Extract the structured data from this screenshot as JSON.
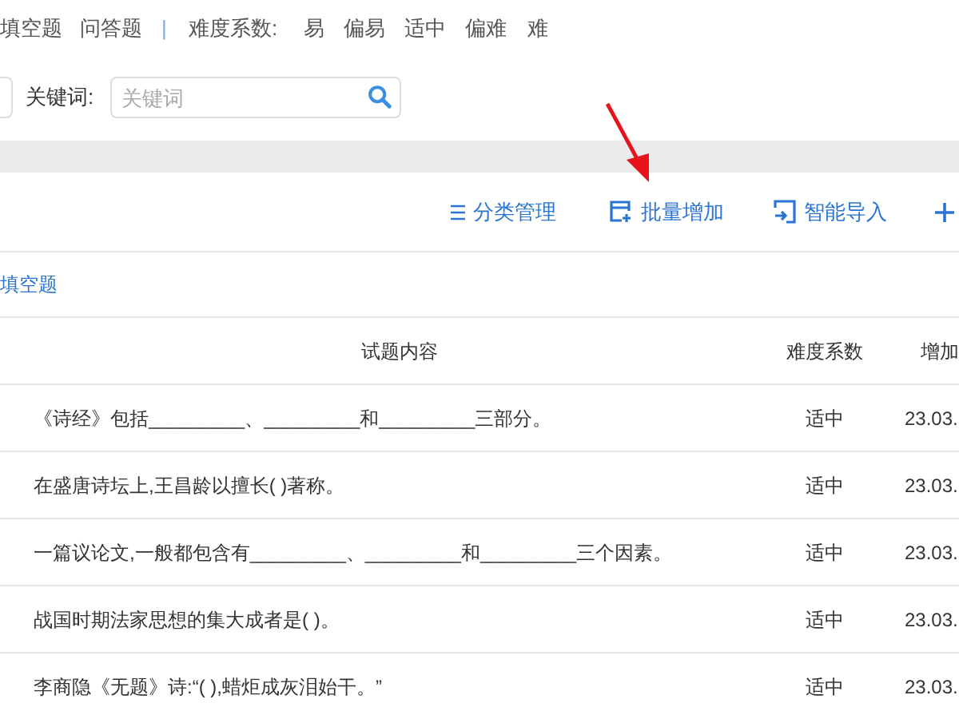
{
  "filter": {
    "types": [
      "填空题",
      "问答题"
    ],
    "separator": "|",
    "difficulty_label": "难度系数:",
    "levels": [
      "易",
      "偏易",
      "适中",
      "偏难",
      "难"
    ],
    "keyword_label": "关键词:",
    "keyword_placeholder": "关键词"
  },
  "toolbar": [
    {
      "kind": "menu",
      "label": "分类管理"
    },
    {
      "kind": "batch",
      "label": "批量增加"
    },
    {
      "kind": "import",
      "label": "智能导入"
    },
    {
      "kind": "add"
    }
  ],
  "category": "填空题",
  "table": {
    "columns": [
      "试题内容",
      "难度系数",
      "增加"
    ],
    "rows": [
      {
        "content": "《诗经》包括_________、_________和_________三部分。",
        "difficulty": "适中",
        "date": "23.03."
      },
      {
        "content": "在盛唐诗坛上,王昌龄以擅长( )著称。",
        "difficulty": "适中",
        "date": "23.03."
      },
      {
        "content": "一篇议论文,一般都包含有_________、_________和_________三个因素。",
        "difficulty": "适中",
        "date": "23.03."
      },
      {
        "content": "战国时期法家思想的集大成者是( )。",
        "difficulty": "适中",
        "date": "23.03."
      },
      {
        "content": "李商隐《无题》诗:“( ),蜡炬成灰泪始干。”",
        "difficulty": "适中",
        "date": "23.03."
      }
    ]
  }
}
